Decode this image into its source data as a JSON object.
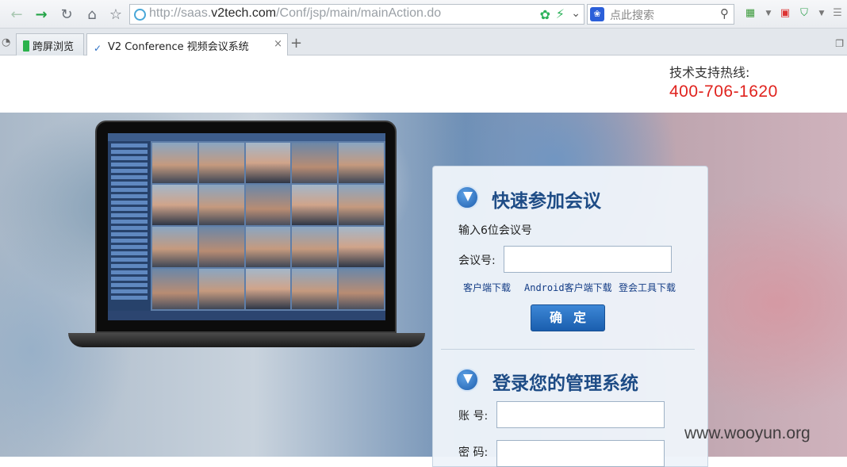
{
  "browser": {
    "url_gray": "http://saas.",
    "url_host": "v2tech.com",
    "url_path": "/Conf/jsp/main/mainAction.do",
    "search_placeholder": "点此搜索",
    "tabs": [
      {
        "label": "跨屏浏览"
      },
      {
        "label": "V2 Conference 视频会议系统",
        "close": "×"
      }
    ],
    "new_tab": "+"
  },
  "header": {
    "hotline_label": "技术支持热线:",
    "hotline_number": "400-706-1620"
  },
  "quick_join": {
    "title": "快速参加会议",
    "hint": "输入6位会议号",
    "meeting_label": "会议号:",
    "meeting_value": "",
    "links": [
      "客户端下载",
      "Android客户端下载",
      "登会工具下载"
    ],
    "submit": "确定"
  },
  "admin_login": {
    "title": "登录您的管理系统",
    "account_label": "账 号:",
    "account_value": "",
    "password_label": "密 码:",
    "password_value": ""
  },
  "watermark": "www.wooyun.org",
  "colors": {
    "hotline": "#e0231e",
    "title": "#1e4c86",
    "button": "#2a72c5"
  }
}
